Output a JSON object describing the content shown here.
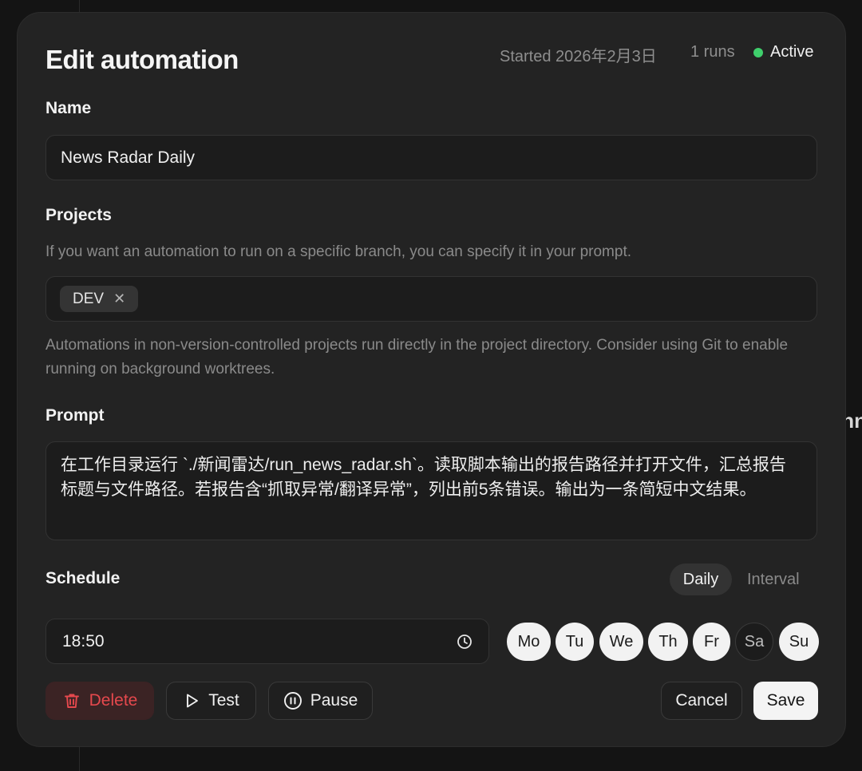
{
  "background": {
    "peek_text": "nn"
  },
  "header": {
    "title": "Edit automation",
    "started": "Started 2026年2月3日",
    "runs": "1 runs",
    "status": "Active",
    "status_color": "#3fcf6c"
  },
  "name": {
    "label": "Name",
    "value": "News Radar Daily"
  },
  "projects": {
    "label": "Projects",
    "help": "If you want an automation to run on a specific branch, you can specify it in your prompt.",
    "chips": [
      {
        "label": "DEV",
        "remove_icon": "close-icon"
      }
    ],
    "note": "Automations in non-version-controlled projects run directly in the project directory. Consider using Git to enable running on background worktrees."
  },
  "prompt": {
    "label": "Prompt",
    "value": "在工作目录运行 `./新闻雷达/run_news_radar.sh`。读取脚本输出的报告路径并打开文件，汇总报告标题与文件路径。若报告含“抓取异常/翻译异常”，列出前5条错误。输出为一条简短中文结果。"
  },
  "schedule": {
    "label": "Schedule",
    "modes": [
      {
        "label": "Daily",
        "selected": true
      },
      {
        "label": "Interval",
        "selected": false
      }
    ],
    "time": "18:50",
    "time_icon": "clock-icon",
    "days": [
      {
        "label": "Mo",
        "selected": true
      },
      {
        "label": "Tu",
        "selected": true
      },
      {
        "label": "We",
        "selected": true
      },
      {
        "label": "Th",
        "selected": true
      },
      {
        "label": "Fr",
        "selected": true
      },
      {
        "label": "Sa",
        "selected": false
      },
      {
        "label": "Su",
        "selected": true
      }
    ]
  },
  "actions": {
    "delete": "Delete",
    "test": "Test",
    "pause": "Pause",
    "cancel": "Cancel",
    "save": "Save",
    "danger_color": "#e5484d"
  }
}
